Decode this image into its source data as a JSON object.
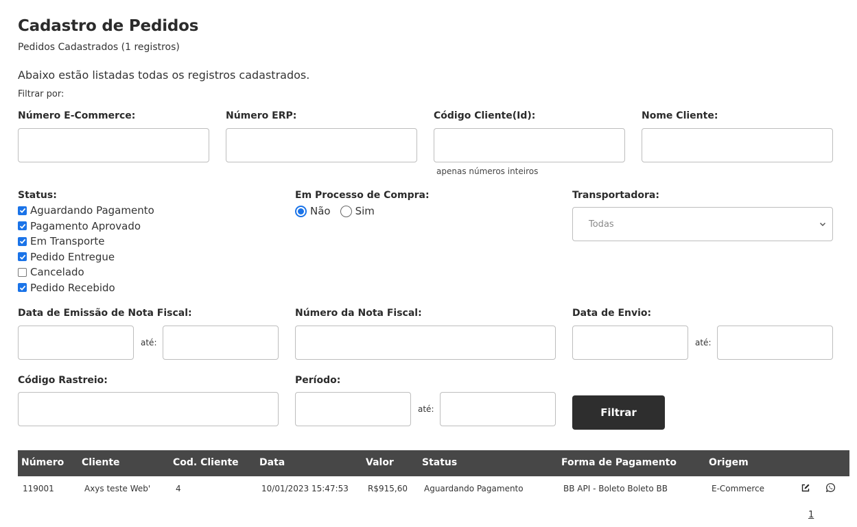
{
  "page": {
    "title": "Cadastro de Pedidos",
    "subtitle": "Pedidos Cadastrados (1 registros)",
    "intro": "Abaixo estão listadas todas os registros cadastrados.",
    "filter_by": "Filtrar por:"
  },
  "filters": {
    "numero_ecommerce": {
      "label": "Número E-Commerce:",
      "value": ""
    },
    "numero_erp": {
      "label": "Número ERP:",
      "value": ""
    },
    "codigo_cliente": {
      "label": "Código Cliente(Id):",
      "value": "",
      "hint": "apenas números inteiros"
    },
    "nome_cliente": {
      "label": "Nome Cliente:",
      "value": ""
    },
    "status": {
      "label": "Status:",
      "options": [
        {
          "label": "Aguardando Pagamento",
          "checked": true
        },
        {
          "label": "Pagamento Aprovado",
          "checked": true
        },
        {
          "label": "Em Transporte",
          "checked": true
        },
        {
          "label": "Pedido Entregue",
          "checked": true
        },
        {
          "label": "Cancelado",
          "checked": false
        },
        {
          "label": "Pedido Recebido",
          "checked": true
        }
      ]
    },
    "em_processo": {
      "label": "Em Processo de Compra:",
      "options": [
        {
          "label": "Não",
          "selected": true
        },
        {
          "label": "Sim",
          "selected": false
        }
      ]
    },
    "transportadora": {
      "label": "Transportadora:",
      "selected": "Todas"
    },
    "data_emissao_nf": {
      "label": "Data de Emissão de Nota Fiscal:",
      "from": "",
      "to": "",
      "separator": "até:"
    },
    "numero_nf": {
      "label": "Número da Nota Fiscal:",
      "value": ""
    },
    "data_envio": {
      "label": "Data de Envio:",
      "from": "",
      "to": "",
      "separator": "até:"
    },
    "codigo_rastreio": {
      "label": "Código Rastreio:",
      "value": ""
    },
    "periodo": {
      "label": "Período:",
      "from": "",
      "to": "",
      "separator": "até:"
    },
    "submit_label": "Filtrar"
  },
  "table": {
    "headers": [
      "Número",
      "Cliente",
      "Cod. Cliente",
      "Data",
      "Valor",
      "Status",
      "Forma de Pagamento",
      "Origem"
    ],
    "rows": [
      {
        "numero": "119001",
        "cliente": "Axys teste Web'",
        "cod_cliente": "4",
        "data": "10/01/2023 15:47:53",
        "valor": "R$915,60",
        "status": "Aguardando Pagamento",
        "forma_pagamento": "BB API - Boleto Boleto BB",
        "origem": "E-Commerce",
        "actions": [
          "edit-icon",
          "whatsapp-icon"
        ]
      }
    ]
  },
  "pagination": {
    "current": "1"
  },
  "colors": {
    "accent": "#1a73e8",
    "header_bg": "#474747",
    "button_bg": "#2e2e2e"
  }
}
